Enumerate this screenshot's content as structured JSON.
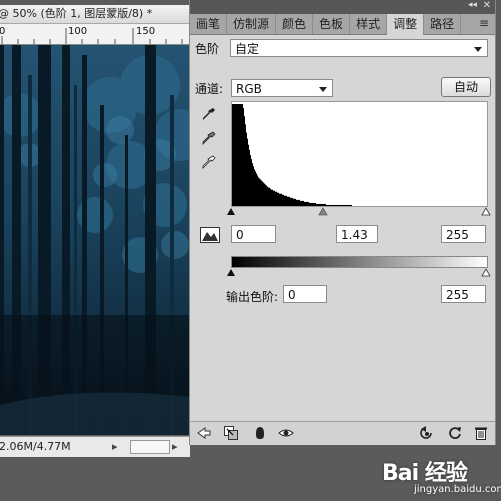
{
  "document": {
    "title": "@ 50% (色阶 1, 图层蒙版/8) *",
    "ruler_labels": [
      "0",
      "100",
      "150"
    ],
    "status_text": "2.06M/4.77M"
  },
  "panel": {
    "tabs": [
      {
        "label": "画笔",
        "active": false
      },
      {
        "label": "仿制源",
        "active": false
      },
      {
        "label": "颜色",
        "active": false
      },
      {
        "label": "色板",
        "active": false
      },
      {
        "label": "样式",
        "active": false
      },
      {
        "label": "调整",
        "active": true
      },
      {
        "label": "路径",
        "active": false
      }
    ],
    "preset_label": "色阶",
    "preset_value": "自定",
    "channel_label": "通道:",
    "channel_value": "RGB",
    "auto_label": "自动",
    "input_black": "0",
    "input_gamma": "1.43",
    "input_white": "255",
    "output_label": "输出色阶:",
    "output_black": "0",
    "output_white": "255"
  },
  "histogram": [
    100,
    100,
    100,
    100,
    100,
    100,
    100,
    100,
    100,
    100,
    100,
    96,
    88,
    80,
    72,
    66,
    60,
    55,
    50,
    46,
    42,
    39,
    36,
    34,
    32,
    30,
    28,
    27,
    26,
    25,
    24,
    23,
    22,
    21,
    20,
    19,
    18,
    18,
    17,
    16,
    16,
    15,
    15,
    14,
    14,
    13,
    13,
    12,
    12,
    12,
    11,
    11,
    10,
    10,
    10,
    9,
    9,
    9,
    8,
    8,
    8,
    7,
    7,
    7,
    6,
    6,
    6,
    6,
    5,
    5,
    5,
    5,
    4,
    4,
    4,
    4,
    4,
    3,
    3,
    3,
    3,
    3,
    3,
    3,
    2,
    2,
    2,
    2,
    2,
    2,
    2,
    2,
    2,
    2,
    1,
    1,
    1,
    1,
    1,
    1,
    1,
    1,
    1,
    1,
    1,
    1,
    1,
    1,
    1,
    1,
    1,
    1,
    1,
    1,
    1,
    1,
    1,
    1,
    1,
    1,
    0,
    0,
    0,
    0,
    0,
    0,
    0,
    0,
    0,
    0,
    0,
    0,
    0,
    0,
    0,
    0,
    0,
    0,
    0,
    0,
    0,
    0,
    0,
    0,
    0,
    0,
    0,
    0,
    0,
    0,
    0,
    0,
    0,
    0,
    0,
    0,
    0,
    0,
    0,
    0,
    0,
    0,
    0,
    0,
    0,
    0,
    0,
    0,
    0,
    0,
    0,
    0,
    0,
    0,
    0,
    0,
    0,
    0,
    0,
    0,
    0,
    0,
    0,
    0,
    0,
    0,
    0,
    0,
    0,
    0,
    0,
    0,
    0,
    0,
    0,
    0,
    0,
    0,
    0,
    0,
    0,
    0,
    0,
    0,
    0,
    0,
    0,
    0,
    0,
    0,
    0,
    0,
    0,
    0,
    0,
    0,
    0,
    0,
    0,
    0,
    0,
    0,
    0,
    0,
    0,
    0,
    0,
    0,
    0,
    0,
    0,
    0,
    0,
    0,
    0,
    0,
    0,
    0,
    0,
    0,
    0,
    0,
    0,
    0,
    0,
    0,
    0,
    0,
    0,
    0,
    0,
    0,
    0,
    0,
    0,
    0,
    0,
    0,
    0,
    0,
    0,
    0,
    0,
    0,
    0,
    0,
    0,
    0
  ],
  "watermark": {
    "text": "Bai 经验",
    "sub": "jingyan.baidu.com"
  },
  "icons": {
    "eyedroppers": [
      "black-point-eyedropper-icon",
      "gray-point-eyedropper-icon",
      "white-point-eyedropper-icon"
    ],
    "bottom": [
      "back-icon",
      "clip-to-layer-icon",
      "mask-icon",
      "visibility-eye-icon",
      "previous-state-icon",
      "reset-icon",
      "delete-icon"
    ]
  }
}
